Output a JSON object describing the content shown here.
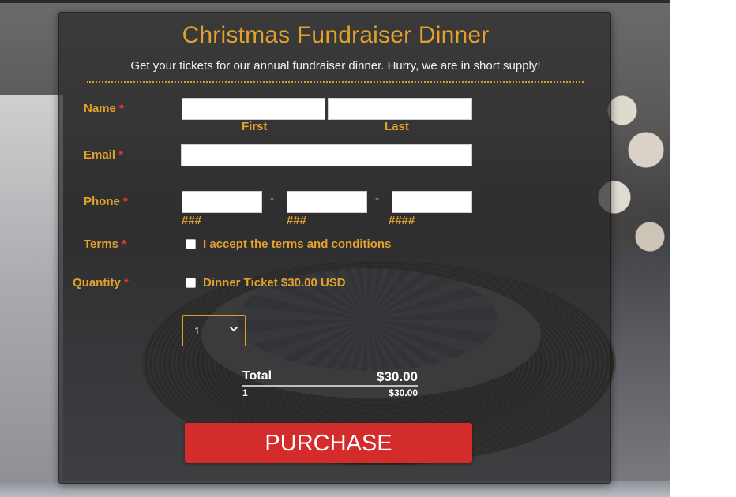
{
  "form": {
    "title": "Christmas Fundraiser Dinner",
    "subtitle": "Get your tickets for our annual fundraiser dinner. Hurry, we are in short supply!",
    "required_marker": "*",
    "fields": {
      "name": {
        "label": "Name",
        "first_sublabel": "First",
        "last_sublabel": "Last",
        "first_value": "",
        "last_value": ""
      },
      "email": {
        "label": "Email",
        "value": ""
      },
      "phone": {
        "label": "Phone",
        "separator": "-",
        "part1_hint": "###",
        "part2_hint": "###",
        "part3_hint": "####",
        "part1_value": "",
        "part2_value": "",
        "part3_value": ""
      },
      "terms": {
        "label": "Terms",
        "checkbox_text": "I accept the terms and conditions",
        "checked": false
      },
      "quantity": {
        "label": "Quantity",
        "product_text": "Dinner Ticket $30.00 USD",
        "checked": false,
        "selected_quantity": "1"
      }
    },
    "summary": {
      "total_label": "Total",
      "total_value": "$30.00",
      "line_quantity": "1",
      "line_amount": "$30.00"
    },
    "purchase_label": "PURCHASE"
  },
  "colors": {
    "accent": "#e1a12a",
    "required": "#e8392f",
    "button": "#d42b2b",
    "card": "#28282a"
  },
  "icons": {
    "select_arrow": "chevron-down-icon"
  }
}
